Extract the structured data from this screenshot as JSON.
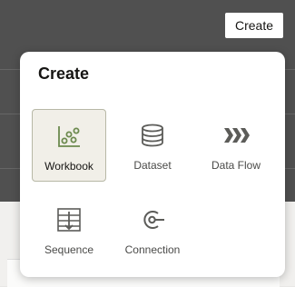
{
  "header": {
    "create_button_label": "Create"
  },
  "popup": {
    "title": "Create",
    "items": [
      {
        "label": "Workbook",
        "icon": "workbook-chart-icon",
        "selected": true
      },
      {
        "label": "Dataset",
        "icon": "database-icon",
        "selected": false
      },
      {
        "label": "Data Flow",
        "icon": "data-flow-icon",
        "selected": false
      },
      {
        "label": "Sequence",
        "icon": "sequence-icon",
        "selected": false
      },
      {
        "label": "Connection",
        "icon": "connection-icon",
        "selected": false
      }
    ],
    "colors": {
      "workbook_icon": "#6c8a4e",
      "icon": "#5c5c59",
      "selected_bg": "#f1efe8"
    }
  }
}
